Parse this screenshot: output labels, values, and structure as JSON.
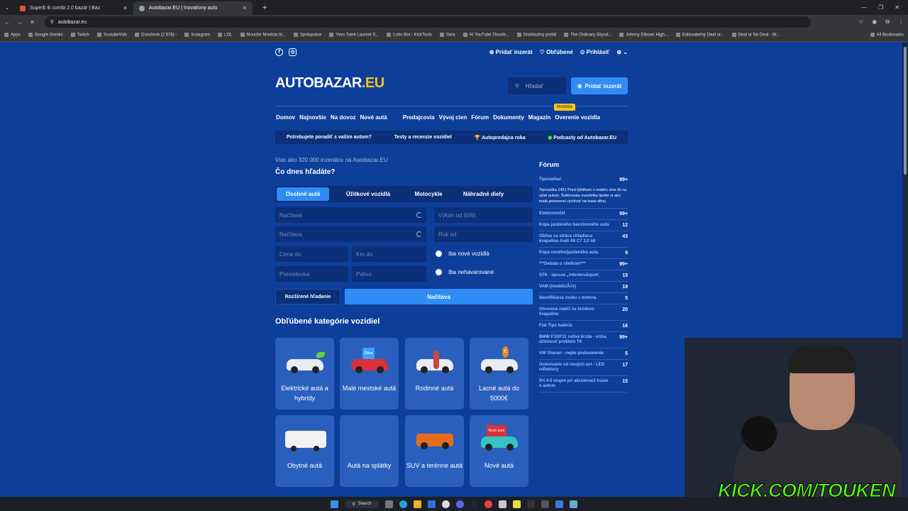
{
  "browser": {
    "tabs": [
      {
        "title": "Superb ik combi 2.0 bazár | Baz",
        "active": false
      },
      {
        "title": "Autobazar.EU | Inovatívny auto",
        "active": true
      }
    ],
    "url": "autobazar.eu",
    "bookmarks": [
      "Apps",
      "Google Gemini",
      "Twitch",
      "YoutubeVids",
      "Doručené (2 678) -",
      "Instagram",
      "LOL",
      "Moncler Montcla bl...",
      "Spolupráce",
      "Yves Saint Laurent S...",
      "Lotto Bot - KickTools",
      "Sora",
      "AI YouTube Thumb...",
      "Distribučný portál",
      "The Ordinary Glycol...",
      "Johnny Elbows High...",
      "Editovateľný Deal or...",
      "Deal or No Deal - W...",
      "All Bookmarks"
    ]
  },
  "header": {
    "social": [
      "facebook-icon",
      "instagram-icon"
    ],
    "add_listing": "Pridať inzerát",
    "favorites": "Obľúbené",
    "login": "Prihlásiť",
    "logo_main": "AUTOBAZAR",
    "logo_tld": ".EU",
    "search_placeholder": "Hľadať",
    "add_button": "Pridať inzerát",
    "nav": [
      "Domov",
      "Najnovšie",
      "Na dovoz",
      "Nové autá",
      "Predajcovia",
      "Vývoj cien",
      "Fórum",
      "Dokumenty",
      "Magazín",
      "Overenie vozidla"
    ],
    "novinka": "Novinka",
    "subnav": [
      "Potrebujete poradiť s vaším autom?",
      "Testy a recenzie vozidiel",
      "Autopredajca roka",
      "Podcasty od Autobazar.EU"
    ]
  },
  "search": {
    "info": "Viac ako 320 000 inzerátov na Autobazar.EU",
    "title": "Čo dnes hľadáte?",
    "tabs": [
      "Osobné autá",
      "Úžitkové vozidlá",
      "Motocykle",
      "Náhradné diely"
    ],
    "fields": {
      "make": "Načítava",
      "model": "Načítava",
      "power": "Výkon od (kW)",
      "year": "Rok od",
      "price": "Cena do",
      "km": "Km do",
      "gearbox": "Prevodovka",
      "fuel": "Palivo"
    },
    "radio_new": "Iba nové vozidlá",
    "radio_undamaged": "Iba nehavarované",
    "advanced": "Rozšírené hľadanie",
    "submit": "Načítava"
  },
  "categories": {
    "title": "Obľúbené kategórie vozidiel",
    "items": [
      {
        "label": "Elektrické autá a hybridy",
        "badge": ""
      },
      {
        "label": "Malé mestské autá",
        "badge": "Žilina"
      },
      {
        "label": "Rodinné autá",
        "badge": ""
      },
      {
        "label": "Lacné autá do 5000€",
        "badge": "€"
      },
      {
        "label": "Obytné autá",
        "badge": ""
      },
      {
        "label": "Autá na splátky",
        "badge": ""
      },
      {
        "label": "SUV a terénne autá",
        "badge": ""
      },
      {
        "label": "Nové autá",
        "badge": "Nové autá"
      }
    ]
  },
  "forum": {
    "title": "Fórum",
    "items": [
      {
        "topic": "Tipovačka!",
        "count": "99+",
        "desc": "Tipovačka 1451 Pred týždňom v nedeľu sme šli na výlet autom. Šoférovala manželka tipnite si akú malá priemernú rýchlosť na trase dlhej"
      },
      {
        "topic": "Elektromobil",
        "count": "99+"
      },
      {
        "topic": "Kúpa jazdeného benzínového auta",
        "count": "12"
      },
      {
        "topic": "Občas sa stráca chladiaca kvapalina Audi A6 C7 3,0 tdi",
        "count": "43"
      },
      {
        "topic": "Kúpa nového/jazdeného auta",
        "count": "9"
      },
      {
        "topic": "***Debata o všetkom***",
        "count": "99+"
      },
      {
        "topic": "STK - úprava „interieru&quot;",
        "count": "15"
      },
      {
        "topic": "VAM (imobilizÃ©r)",
        "count": "19"
      },
      {
        "topic": "Identifikácia zvuku z motora.",
        "count": "5"
      },
      {
        "topic": "Otvorená nádrž na brzdovú kvapalinu",
        "count": "20"
      },
      {
        "topic": "Fiat Tipo batéria",
        "count": "16"
      },
      {
        "topic": "BMW F10/F11 ručná brzda - nízka účinnosť problem TK",
        "count": "99+"
      },
      {
        "topic": "VW Sharan - nejde podsvietenie",
        "count": "5"
      },
      {
        "topic": "Oslnovanie od nových aut - LED reflektory",
        "count": "17"
      },
      {
        "topic": "Pri 4-5 stupni pri akceleracii trasie s autom",
        "count": "15"
      }
    ]
  },
  "taskbar": {
    "search": "Search"
  },
  "overlay": {
    "stream": "KICK.COM/TOUKEN"
  },
  "colors": {
    "bg": "#0d3e9a",
    "accent": "#2f8cf5",
    "logo_tld": "#f5c518",
    "kick": "#53fc18"
  }
}
